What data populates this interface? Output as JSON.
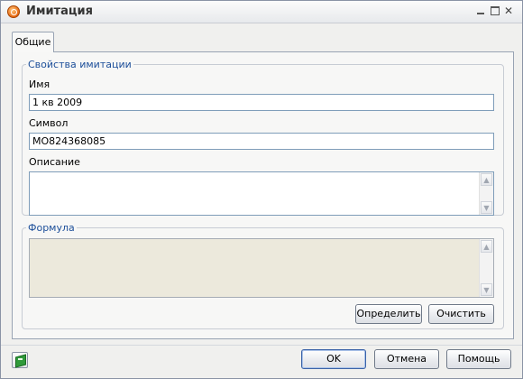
{
  "window": {
    "title": "Имитация"
  },
  "tabs": [
    {
      "label": "Общие"
    }
  ],
  "properties": {
    "legend": "Свойства имитации",
    "name_label": "Имя",
    "name_value": "1 кв 2009",
    "symbol_label": "Символ",
    "symbol_value": "MO824368085",
    "description_label": "Описание",
    "description_value": ""
  },
  "formula": {
    "legend": "Формула",
    "value": "",
    "define_button": "Определить",
    "clear_button": "Очистить"
  },
  "footer": {
    "ok_button": "OK",
    "cancel_button": "Отмена",
    "help_button": "Помощь"
  },
  "colors": {
    "group_legend": "#1d4f9a",
    "formula_background": "#ece9dc",
    "app_icon": "#e86a12"
  },
  "icons": {
    "app": "simulation-app-icon",
    "help": "help-book-icon"
  }
}
